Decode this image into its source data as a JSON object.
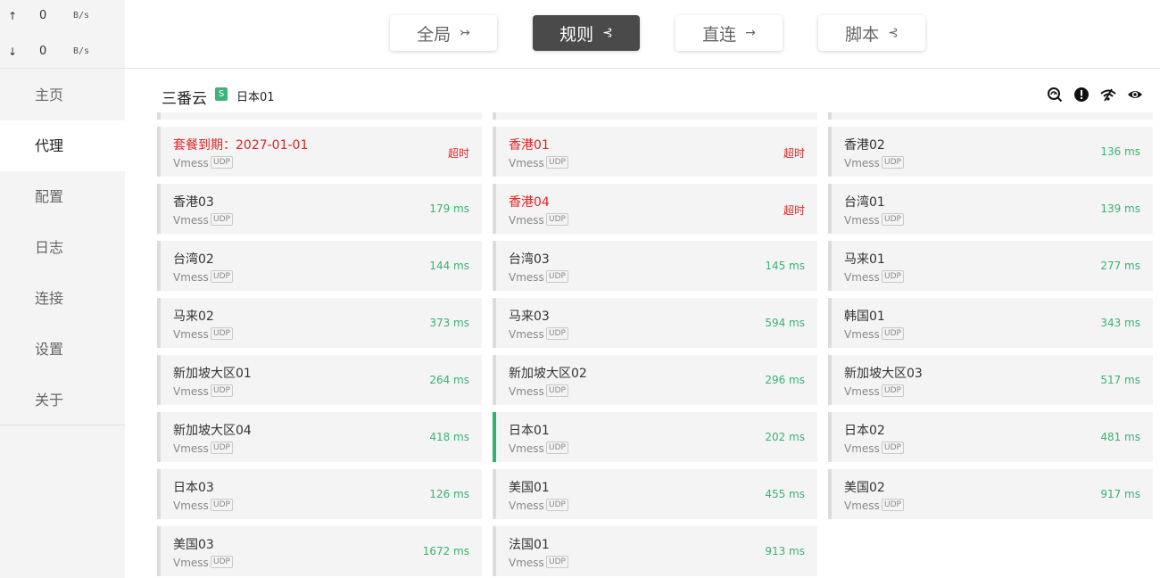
{
  "traffic": {
    "up": {
      "arrow": "↑",
      "value": "0",
      "unit": "B/s"
    },
    "down": {
      "arrow": "↓",
      "value": "0",
      "unit": "B/s"
    }
  },
  "nav": {
    "items": [
      {
        "label": "主页",
        "active": false
      },
      {
        "label": "代理",
        "active": true
      },
      {
        "label": "配置",
        "active": false
      },
      {
        "label": "日志",
        "active": false
      },
      {
        "label": "连接",
        "active": false
      },
      {
        "label": "设置",
        "active": false
      },
      {
        "label": "关于",
        "active": false
      }
    ]
  },
  "modes": [
    {
      "label": "全局",
      "icon": "↣",
      "active": false
    },
    {
      "label": "规则",
      "icon": "⊰",
      "active": true
    },
    {
      "label": "直连",
      "icon": "→",
      "active": false
    },
    {
      "label": "脚本",
      "icon": "⊰",
      "active": false
    }
  ],
  "group": {
    "name": "三番云",
    "badge": "S",
    "selected": "日本01",
    "icons": [
      "speed-test-icon",
      "alert-icon",
      "wifi-icon",
      "eye-icon"
    ],
    "accent": "#3cb37a"
  },
  "colors": {
    "ok": "#39b274",
    "error": "#e02424",
    "selected": "#2fb36d"
  },
  "proxies": [
    {
      "name": "套餐到期：2027-01-01",
      "type": "Vmess",
      "udp": "UDP",
      "delay": "超时",
      "error": true
    },
    {
      "name": "香港01",
      "type": "Vmess",
      "udp": "UDP",
      "delay": "超时",
      "error": true
    },
    {
      "name": "香港02",
      "type": "Vmess",
      "udp": "UDP",
      "delay": "136 ms"
    },
    {
      "name": "香港03",
      "type": "Vmess",
      "udp": "UDP",
      "delay": "179 ms"
    },
    {
      "name": "香港04",
      "type": "Vmess",
      "udp": "UDP",
      "delay": "超时",
      "error": true
    },
    {
      "name": "台湾01",
      "type": "Vmess",
      "udp": "UDP",
      "delay": "139 ms"
    },
    {
      "name": "台湾02",
      "type": "Vmess",
      "udp": "UDP",
      "delay": "144 ms"
    },
    {
      "name": "台湾03",
      "type": "Vmess",
      "udp": "UDP",
      "delay": "145 ms"
    },
    {
      "name": "马来01",
      "type": "Vmess",
      "udp": "UDP",
      "delay": "277 ms"
    },
    {
      "name": "马来02",
      "type": "Vmess",
      "udp": "UDP",
      "delay": "373 ms"
    },
    {
      "name": "马来03",
      "type": "Vmess",
      "udp": "UDP",
      "delay": "594 ms"
    },
    {
      "name": "韩国01",
      "type": "Vmess",
      "udp": "UDP",
      "delay": "343 ms"
    },
    {
      "name": "新加坡大区01",
      "type": "Vmess",
      "udp": "UDP",
      "delay": "264 ms"
    },
    {
      "name": "新加坡大区02",
      "type": "Vmess",
      "udp": "UDP",
      "delay": "296 ms"
    },
    {
      "name": "新加坡大区03",
      "type": "Vmess",
      "udp": "UDP",
      "delay": "517 ms"
    },
    {
      "name": "新加坡大区04",
      "type": "Vmess",
      "udp": "UDP",
      "delay": "418 ms"
    },
    {
      "name": "日本01",
      "type": "Vmess",
      "udp": "UDP",
      "delay": "202 ms",
      "selected": true
    },
    {
      "name": "日本02",
      "type": "Vmess",
      "udp": "UDP",
      "delay": "481 ms"
    },
    {
      "name": "日本03",
      "type": "Vmess",
      "udp": "UDP",
      "delay": "126 ms"
    },
    {
      "name": "美国01",
      "type": "Vmess",
      "udp": "UDP",
      "delay": "455 ms"
    },
    {
      "name": "美国02",
      "type": "Vmess",
      "udp": "UDP",
      "delay": "917 ms"
    },
    {
      "name": "美国03",
      "type": "Vmess",
      "udp": "UDP",
      "delay": "1672 ms"
    },
    {
      "name": "法国01",
      "type": "Vmess",
      "udp": "UDP",
      "delay": "913 ms"
    }
  ]
}
